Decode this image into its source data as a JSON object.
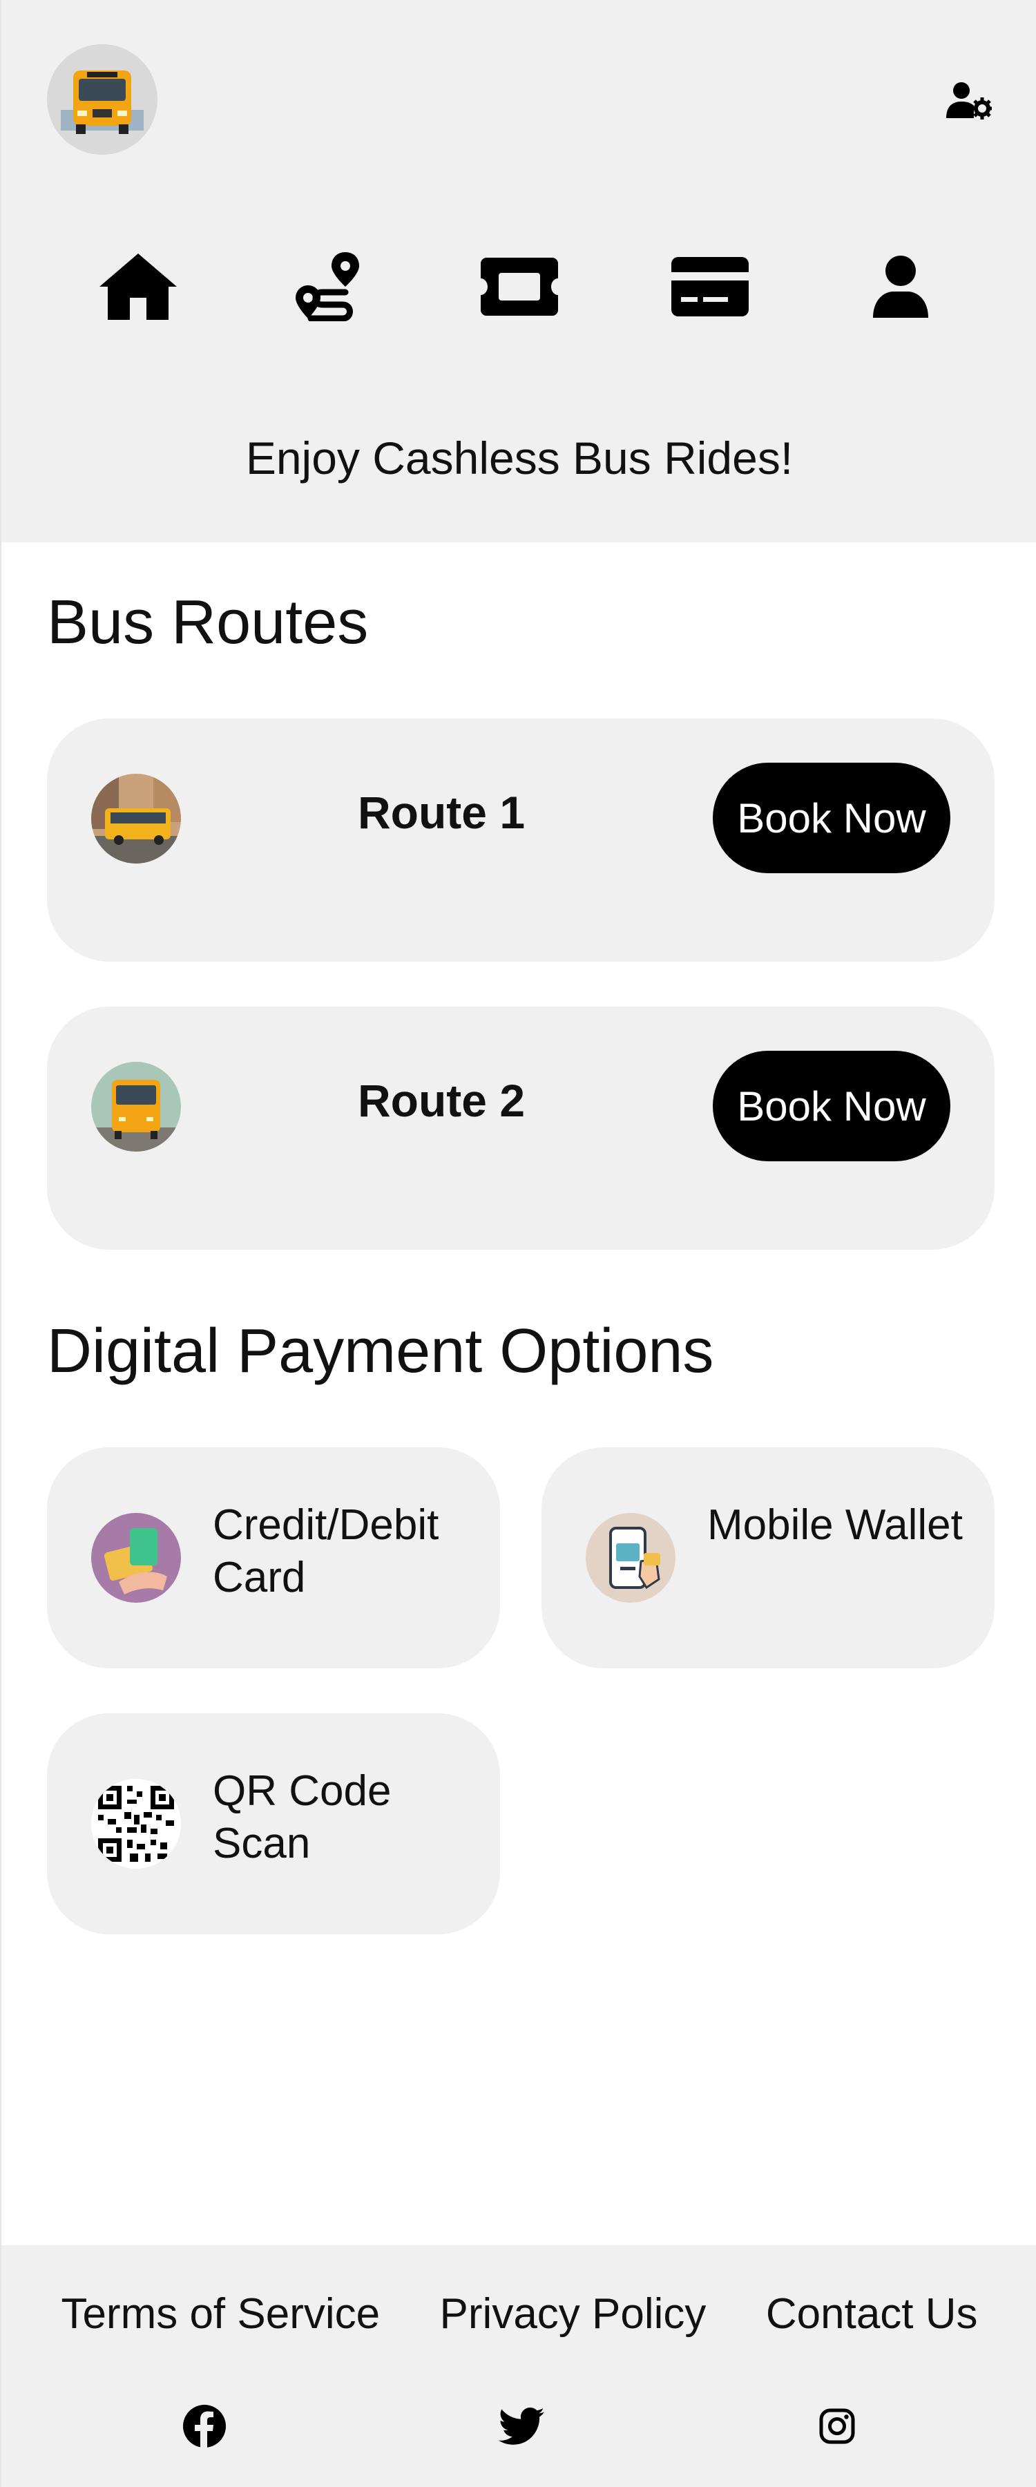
{
  "header": {
    "logo_icon": "school-bus-logo",
    "settings_icon": "user-settings-icon"
  },
  "nav": {
    "items": [
      {
        "icon": "home-icon"
      },
      {
        "icon": "route-icon"
      },
      {
        "icon": "ticket-icon"
      },
      {
        "icon": "credit-card-icon"
      },
      {
        "icon": "user-icon"
      }
    ]
  },
  "banner": {
    "text": "Enjoy Cashless Bus Rides!"
  },
  "routes": {
    "title": "Bus Routes",
    "items": [
      {
        "name": "Route 1",
        "button": "Book Now",
        "thumb": "city-bus-image"
      },
      {
        "name": "Route 2",
        "button": "Book Now",
        "thumb": "school-bus-image"
      }
    ]
  },
  "payments": {
    "title": "Digital Payment Options",
    "items": [
      {
        "label": "Credit/Debit Card",
        "thumb": "cards-image"
      },
      {
        "label": "Mobile Wallet",
        "thumb": "phone-wallet-image"
      },
      {
        "label": "QR Code Scan",
        "thumb": "qr-code-image"
      }
    ]
  },
  "footer": {
    "links": [
      "Terms of Service",
      "Privacy Policy",
      "Contact Us"
    ],
    "social": [
      {
        "icon": "facebook-icon"
      },
      {
        "icon": "twitter-icon"
      },
      {
        "icon": "instagram-icon"
      }
    ]
  },
  "colors": {
    "panel": "#f0f0f0",
    "button": "#000000",
    "button_text": "#ffffff"
  }
}
